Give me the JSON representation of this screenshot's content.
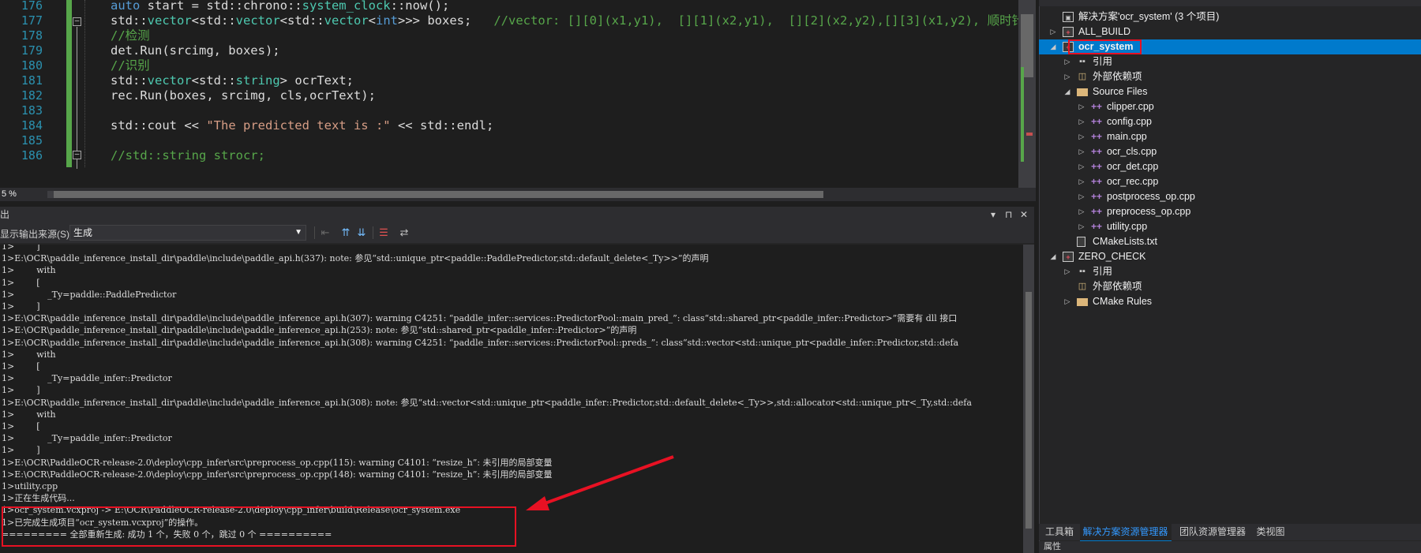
{
  "editor": {
    "lines": [
      {
        "n": "176",
        "segments": [
          {
            "c": "kw",
            "t": "auto"
          },
          {
            "c": "",
            "t": " start = std::chrono::"
          },
          {
            "c": "ty",
            "t": "system_clock"
          },
          {
            "c": "",
            "t": "::now();"
          }
        ]
      },
      {
        "n": "177",
        "segments": [
          {
            "c": "",
            "t": "std::"
          },
          {
            "c": "ty",
            "t": "vector"
          },
          {
            "c": "",
            "t": "<std::"
          },
          {
            "c": "ty",
            "t": "vector"
          },
          {
            "c": "",
            "t": "<std::"
          },
          {
            "c": "ty",
            "t": "vector"
          },
          {
            "c": "",
            "t": "<"
          },
          {
            "c": "kw",
            "t": "int"
          },
          {
            "c": "",
            "t": ">>> boxes;   "
          },
          {
            "c": "cm",
            "t": "//vector: [][0](x1,y1),  [][1](x2,y1),  [][2](x2,y2),[][3](x1,y2), 顺时针四个角"
          }
        ]
      },
      {
        "n": "178",
        "segments": [
          {
            "c": "cm",
            "t": "//检测"
          }
        ]
      },
      {
        "n": "179",
        "segments": [
          {
            "c": "",
            "t": "det.Run(srcimg, boxes);"
          }
        ]
      },
      {
        "n": "180",
        "segments": [
          {
            "c": "cm",
            "t": "//识别"
          }
        ]
      },
      {
        "n": "181",
        "segments": [
          {
            "c": "",
            "t": "std::"
          },
          {
            "c": "ty",
            "t": "vector"
          },
          {
            "c": "",
            "t": "<std::"
          },
          {
            "c": "ty",
            "t": "string"
          },
          {
            "c": "",
            "t": "> ocrText;"
          }
        ]
      },
      {
        "n": "182",
        "segments": [
          {
            "c": "",
            "t": "rec.Run(boxes, srcimg, cls,ocrText);"
          }
        ]
      },
      {
        "n": "183",
        "segments": []
      },
      {
        "n": "184",
        "segments": [
          {
            "c": "",
            "t": "std::cout << "
          },
          {
            "c": "st",
            "t": "\"The predicted text is :\""
          },
          {
            "c": "",
            "t": " << std::endl;"
          }
        ]
      },
      {
        "n": "185",
        "segments": []
      },
      {
        "n": "186",
        "segments": [
          {
            "c": "cm",
            "t": "//std::string strocr;"
          }
        ]
      }
    ],
    "zoom_label": "5 %"
  },
  "output": {
    "title": "出",
    "pin_label": "▾ ⊓ ✕",
    "source_label": "显示输出来源(S):",
    "source_value": "生成",
    "lines": [
      "1>        ]",
      "1>E:\\OCR\\paddle_inference_install_dir\\paddle\\include\\paddle_api.h(337): note: 参见“std::unique_ptr<paddle::PaddlePredictor,std::default_delete<_Ty>>”的声明",
      "1>        with",
      "1>        [",
      "1>            _Ty=paddle::PaddlePredictor",
      "1>        ]",
      "1>E:\\OCR\\paddle_inference_install_dir\\paddle\\include\\paddle_inference_api.h(307): warning C4251: “paddle_infer::services::PredictorPool::main_pred_”: class“std::shared_ptr<paddle_infer::Predictor>”需要有 dll 接口",
      "1>E:\\OCR\\paddle_inference_install_dir\\paddle\\include\\paddle_inference_api.h(253): note: 参见“std::shared_ptr<paddle_infer::Predictor>”的声明",
      "1>E:\\OCR\\paddle_inference_install_dir\\paddle\\include\\paddle_inference_api.h(308): warning C4251: “paddle_infer::services::PredictorPool::preds_”: class“std::vector<std::unique_ptr<paddle_infer::Predictor,std::defa",
      "1>        with",
      "1>        [",
      "1>            _Ty=paddle_infer::Predictor",
      "1>        ]",
      "1>E:\\OCR\\paddle_inference_install_dir\\paddle\\include\\paddle_inference_api.h(308): note: 参见“std::vector<std::unique_ptr<paddle_infer::Predictor,std::default_delete<_Ty>>,std::allocator<std::unique_ptr<_Ty,std::defa",
      "1>        with",
      "1>        [",
      "1>            _Ty=paddle_infer::Predictor",
      "1>        ]",
      "1>E:\\OCR\\PaddleOCR-release-2.0\\deploy\\cpp_infer\\src\\preprocess_op.cpp(115): warning C4101: “resize_h”: 未引用的局部变量",
      "1>E:\\OCR\\PaddleOCR-release-2.0\\deploy\\cpp_infer\\src\\preprocess_op.cpp(148): warning C4101: “resize_h”: 未引用的局部变量",
      "1>utility.cpp",
      "1>正在生成代码...",
      "1>ocr_system.vcxproj -> E:\\OCR\\PaddleOCR-release-2.0\\deploy\\cpp_infer\\build\\Release\\ocr_system.exe",
      "1>已完成生成项目“ocr_system.vcxproj”的操作。",
      "========= 全部重新生成: 成功 1 个，失败 0 个，跳过 0 个 =========="
    ]
  },
  "solution": {
    "items": [
      {
        "label": "解决方案'ocr_system' (3 个项目)",
        "icon": "solution-icon",
        "level": 0,
        "exp": ""
      },
      {
        "label": "ALL_BUILD",
        "icon": "project-icon",
        "level": 0,
        "exp": "▷"
      },
      {
        "label": "ocr_system",
        "icon": "project-icon",
        "level": 0,
        "exp": "◢",
        "selected": true
      },
      {
        "label": "引用",
        "icon": "reference-icon",
        "level": 1,
        "exp": "▷"
      },
      {
        "label": "外部依赖项",
        "icon": "external-deps-icon",
        "level": 1,
        "exp": "▷"
      },
      {
        "label": "Source Files",
        "icon": "folder-icon",
        "level": 1,
        "exp": "◢"
      },
      {
        "label": "clipper.cpp",
        "icon": "cpp-file-icon",
        "level": 2,
        "exp": "▷"
      },
      {
        "label": "config.cpp",
        "icon": "cpp-file-icon",
        "level": 2,
        "exp": "▷"
      },
      {
        "label": "main.cpp",
        "icon": "cpp-file-icon",
        "level": 2,
        "exp": "▷"
      },
      {
        "label": "ocr_cls.cpp",
        "icon": "cpp-file-icon",
        "level": 2,
        "exp": "▷"
      },
      {
        "label": "ocr_det.cpp",
        "icon": "cpp-file-icon",
        "level": 2,
        "exp": "▷"
      },
      {
        "label": "ocr_rec.cpp",
        "icon": "cpp-file-icon",
        "level": 2,
        "exp": "▷"
      },
      {
        "label": "postprocess_op.cpp",
        "icon": "cpp-file-icon",
        "level": 2,
        "exp": "▷"
      },
      {
        "label": "preprocess_op.cpp",
        "icon": "cpp-file-icon",
        "level": 2,
        "exp": "▷"
      },
      {
        "label": "utility.cpp",
        "icon": "cpp-file-icon",
        "level": 2,
        "exp": "▷"
      },
      {
        "label": "CMakeLists.txt",
        "icon": "text-file-icon",
        "level": 1,
        "exp": ""
      },
      {
        "label": "ZERO_CHECK",
        "icon": "project-icon",
        "level": 0,
        "exp": "◢"
      },
      {
        "label": "引用",
        "icon": "reference-icon",
        "level": 1,
        "exp": "▷"
      },
      {
        "label": "外部依赖项",
        "icon": "external-deps-icon",
        "level": 1,
        "exp": ""
      },
      {
        "label": "CMake Rules",
        "icon": "folder-icon",
        "level": 1,
        "exp": "▷"
      }
    ],
    "tabs": [
      {
        "label": "工具箱",
        "active": false
      },
      {
        "label": "解决方案资源管理器",
        "active": true
      },
      {
        "label": "团队资源管理器",
        "active": false
      },
      {
        "label": "类视图",
        "active": false
      }
    ],
    "bottom_label": "属性"
  },
  "colors": {
    "accent": "#007acc",
    "highlight": "#e81123",
    "comment": "#57a64a",
    "keyword": "#569cd6",
    "type": "#4ec9b0",
    "string": "#d69d85"
  }
}
